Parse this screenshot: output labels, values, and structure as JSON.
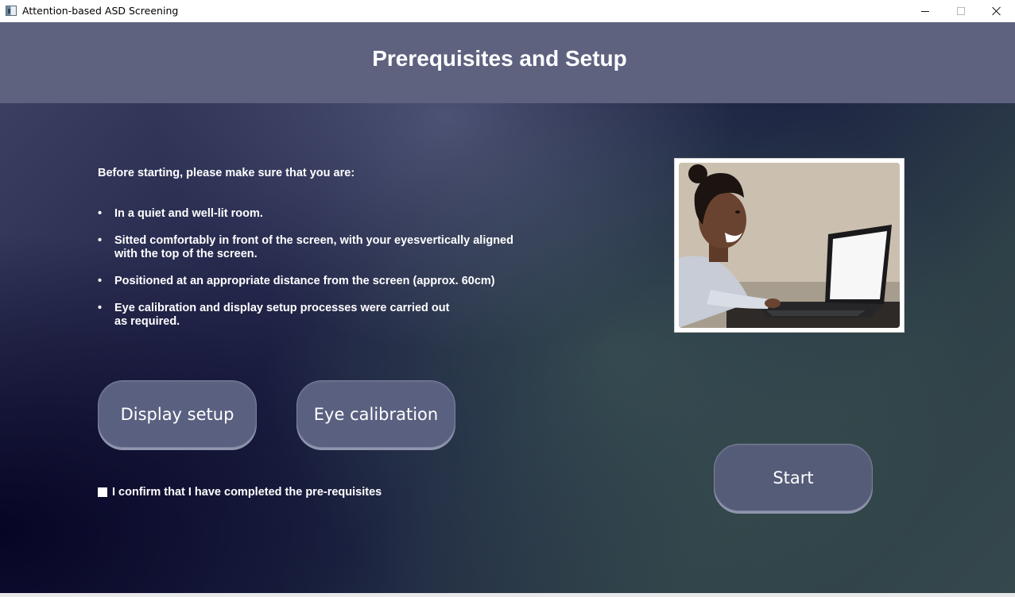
{
  "window": {
    "title": "Attention-based ASD Screening"
  },
  "header": {
    "title": "Prerequisites and Setup"
  },
  "instructions": {
    "intro": "Before starting, please make sure that you are:",
    "bullets": [
      "In a quiet and well-lit room.",
      "Sitted comfortably in front of the screen, with your eyesvertically aligned\n with the top of the screen.",
      "Positioned at an appropriate distance from the screen (approx. 60cm)",
      "Eye calibration and display setup processes were carried out\n as required."
    ]
  },
  "buttons": {
    "display_setup": "Display setup",
    "eye_calibration": "Eye calibration",
    "start": "Start"
  },
  "confirmation": {
    "label": "I confirm that I have completed the pre-requisites",
    "checked": false
  },
  "colors": {
    "header_band": "#5e627f",
    "button_fill": "#5a6080",
    "text": "#ffffff"
  },
  "icons": {
    "app": "app-window-icon",
    "minimize": "minimize-icon",
    "maximize": "maximize-icon",
    "close": "close-icon"
  }
}
